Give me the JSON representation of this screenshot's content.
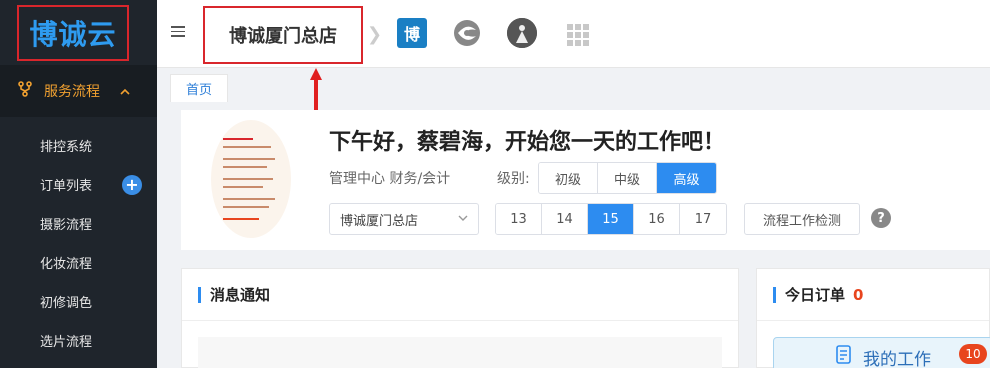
{
  "sidebar": {
    "logo_text": "博诚云",
    "group": {
      "icon": "flow-icon",
      "label": "服务流程",
      "chevron": "chevron-up-icon"
    },
    "items": [
      {
        "label": "排控系统"
      },
      {
        "label": "订单列表"
      },
      {
        "label": "摄影流程"
      },
      {
        "label": "化妆流程"
      },
      {
        "label": "初修调色"
      },
      {
        "label": "选片流程"
      }
    ],
    "add_icon": "+"
  },
  "topbar": {
    "shop_name": "博诚厦门总店",
    "separator": "❯",
    "app_bo_label": "博"
  },
  "tabs": {
    "home": "首页"
  },
  "welcome": {
    "greeting": "下午好，蔡碧海，开始您一天的工作吧！",
    "role": "管理中心  财务/会计",
    "level_label": "级别:",
    "levels": [
      "初级",
      "中级",
      "高级"
    ],
    "level_selected": "高级",
    "shop_select": "博诚厦门总店",
    "numbers": [
      "13",
      "14",
      "15",
      "16",
      "17"
    ],
    "number_selected": "15",
    "check_button": "流程工作检测",
    "help": "?"
  },
  "cards": {
    "messages_title": "消息通知",
    "orders_title": "今日订单",
    "orders_count": "0",
    "my_work_label": "我的工作",
    "my_work_badge": "10"
  },
  "colors": {
    "accent": "#2d8cf0",
    "highlight_border": "#d9262c",
    "sidebar_bg": "#1f252c",
    "active_group": "#f0a030"
  }
}
